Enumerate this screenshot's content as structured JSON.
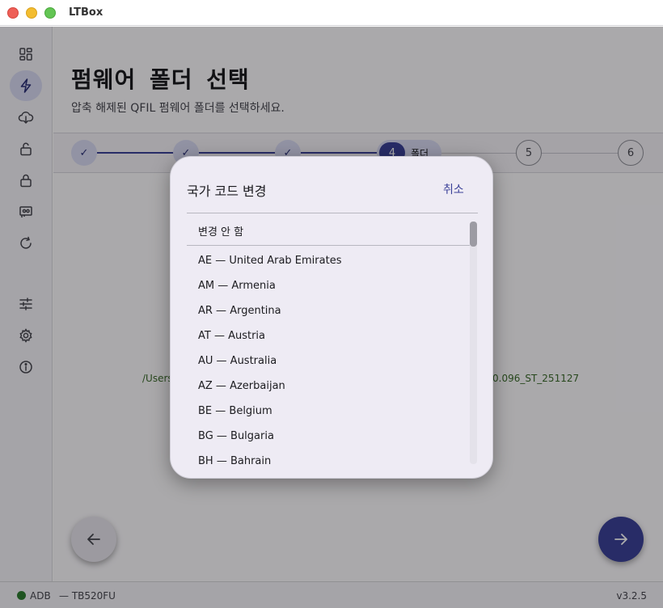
{
  "window": {
    "title": "LTBox"
  },
  "page": {
    "title": "펌웨어 폴더 선택",
    "subtitle": "압축 해제된 QFIL 펌웨어 폴더를 선택하세요."
  },
  "stepper": {
    "done_mark": "✓",
    "active_number": "4",
    "active_label": "폴더",
    "step5": "5",
    "step6": "6"
  },
  "selected_path": {
    "left_fragment": "/Users",
    "right_fragment": "0.096_ST_251127"
  },
  "dialog": {
    "title": "국가 코드 변경",
    "cancel_label": "취소",
    "options": [
      "변경 안 함",
      "AE — United Arab Emirates",
      "AM — Armenia",
      "AR — Argentina",
      "AT — Austria",
      "AU — Australia",
      "AZ — Azerbaijan",
      "BE — Belgium",
      "BG — Bulgaria",
      "BH — Bahrain"
    ]
  },
  "status": {
    "adb_label": "ADB",
    "device": "— TB520FU",
    "version": "v3.2.5"
  },
  "icons": {
    "rail": [
      "dashboard-icon",
      "flash-icon",
      "cloud-download-icon",
      "unlock-icon",
      "lock-icon",
      "device-icon",
      "refresh-icon",
      "tune-icon",
      "settings-icon",
      "info-icon"
    ],
    "back": "arrow-left-icon",
    "next": "arrow-right-icon"
  },
  "colors": {
    "accent": "#3c4299",
    "accent_container": "#d8d9f2",
    "path_text": "#3b6b2c",
    "status_ok": "#2e7d32"
  }
}
